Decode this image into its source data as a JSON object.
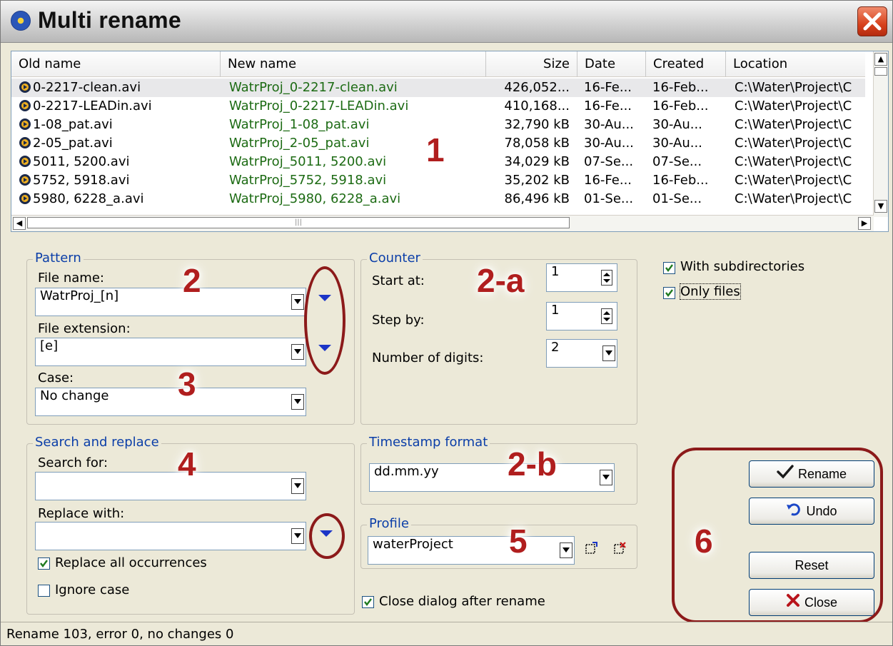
{
  "window": {
    "title": "Multi rename"
  },
  "filelist": {
    "columns": [
      "Old name",
      "New name",
      "Size",
      "Date",
      "Created",
      "Location"
    ],
    "rows": [
      {
        "old": "0-2217-clean.avi",
        "new": "WatrProj_0-2217-clean.avi",
        "size": "426,052...",
        "date": "16-Fe...",
        "created": "16-Feb...",
        "location": "C:\\Water\\Project\\C"
      },
      {
        "old": "0-2217-LEADin.avi",
        "new": "WatrProj_0-2217-LEADin.avi",
        "size": "410,168...",
        "date": "16-Fe...",
        "created": "16-Feb...",
        "location": "C:\\Water\\Project\\C"
      },
      {
        "old": "1-08_pat.avi",
        "new": "WatrProj_1-08_pat.avi",
        "size": "32,790 kB",
        "date": "30-Au...",
        "created": "30-Au...",
        "location": "C:\\Water\\Project\\C"
      },
      {
        "old": "2-05_pat.avi",
        "new": "WatrProj_2-05_pat.avi",
        "size": "78,058 kB",
        "date": "30-Au...",
        "created": "30-Au...",
        "location": "C:\\Water\\Project\\C"
      },
      {
        "old": "5011, 5200.avi",
        "new": "WatrProj_5011, 5200.avi",
        "size": "34,029 kB",
        "date": "07-Se...",
        "created": "07-Se...",
        "location": "C:\\Water\\Project\\C"
      },
      {
        "old": "5752, 5918.avi",
        "new": "WatrProj_5752, 5918.avi",
        "size": "35,202 kB",
        "date": "16-Fe...",
        "created": "16-Feb...",
        "location": "C:\\Water\\Project\\C"
      },
      {
        "old": "5980, 6228_a.avi",
        "new": "WatrProj_5980, 6228_a.avi",
        "size": "86,496 kB",
        "date": "01-Se...",
        "created": "01-Se...",
        "location": "C:\\Water\\Project\\C"
      }
    ]
  },
  "pattern": {
    "legend": "Pattern",
    "file_name_label": "File name:",
    "file_name_value": "WatrProj_[n]",
    "file_ext_label": "File extension:",
    "file_ext_value": "[e]",
    "case_label": "Case:",
    "case_value": "No change"
  },
  "counter": {
    "legend": "Counter",
    "start_label": "Start at:",
    "start_value": "1",
    "step_label": "Step by:",
    "step_value": "1",
    "digits_label": "Number of digits:",
    "digits_value": "2"
  },
  "options": {
    "subdirs_label": "With subdirectories",
    "subdirs_checked": true,
    "onlyfiles_label": "Only files",
    "onlyfiles_checked": true
  },
  "search": {
    "legend": "Search and replace",
    "search_label": "Search for:",
    "search_value": "",
    "replace_label": "Replace with:",
    "replace_value": "",
    "replace_all_label": "Replace all occurrences",
    "replace_all_checked": true,
    "ignore_case_label": "Ignore case",
    "ignore_case_checked": false
  },
  "timestamp": {
    "legend": "Timestamp format",
    "value": "dd.mm.yy"
  },
  "profile": {
    "legend": "Profile",
    "value": "waterProject"
  },
  "close_after": {
    "label": "Close dialog after rename",
    "checked": true
  },
  "buttons": {
    "rename": "Rename",
    "undo": "Undo",
    "reset": "Reset",
    "close": "Close"
  },
  "annotations": [
    "1",
    "2",
    "2-a",
    "3",
    "4",
    "2-b",
    "5",
    "6"
  ],
  "status": {
    "text": "Rename 103, error 0, no changes 0"
  },
  "colors": {
    "annotation": "#b01e1e",
    "new_name": "#1d6b14",
    "legend": "#0b3ea8"
  }
}
